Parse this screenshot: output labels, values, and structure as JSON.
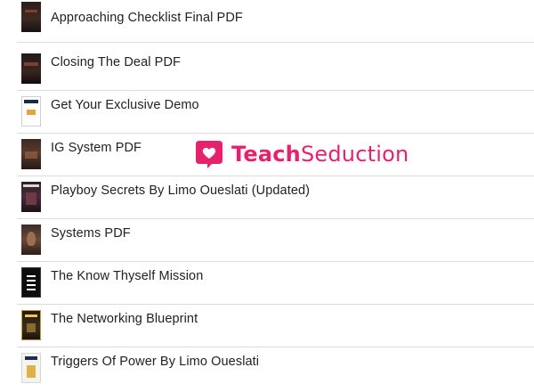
{
  "items": [
    {
      "title": "Approaching Checklist Final PDF",
      "thumb": "dark-ebook-cover"
    },
    {
      "title": "Closing The Deal PDF",
      "thumb": "dark-ebook-cover"
    },
    {
      "title": "Get Your Exclusive Demo",
      "thumb": "webpage-thumbnail"
    },
    {
      "title": "IG System PDF",
      "thumb": "brown-ebook-cover"
    },
    {
      "title": "Playboy Secrets By Limo Oueslati (Updated)",
      "thumb": "playboy-secrets-cover"
    },
    {
      "title": "Systems PDF",
      "thumb": "portrait-ebook-cover"
    },
    {
      "title": "The Know Thyself Mission",
      "thumb": "black-checklist-cover"
    },
    {
      "title": "The Networking Blueprint",
      "thumb": "gold-ebook-cover"
    },
    {
      "title": "Triggers Of Power By Limo Oueslati",
      "thumb": "triggers-of-power-cover"
    }
  ],
  "watermark": {
    "brand_bold": "Teach",
    "brand_regular": "Seduction",
    "icon": "heart-speech-bubble-icon",
    "color": "#e6226d"
  },
  "colors": {
    "text": "#222222",
    "divider": "#dcdcdc"
  }
}
